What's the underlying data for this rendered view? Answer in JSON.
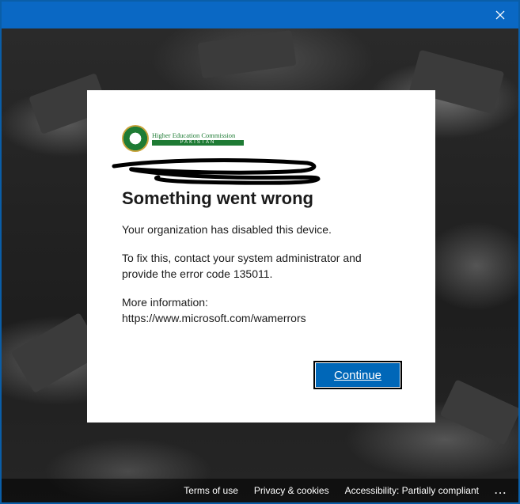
{
  "window": {
    "close_glyph": "✕",
    "accent": "#0a68c4"
  },
  "dialog": {
    "logo": {
      "name": "Higher Education Commission",
      "country": "PAKISTAN"
    },
    "title": "Something went wrong",
    "message": "Your organization has disabled this device.",
    "fix": "To fix this, contact your system administrator and provide the error code 135011.",
    "more_info_label": "More information:",
    "more_info_url": "https://www.microsoft.com/wamerrors",
    "continue_label": "Continue",
    "button_color": "#0067b8"
  },
  "footer": {
    "terms": "Terms of use",
    "privacy": "Privacy & cookies",
    "accessibility": "Accessibility: Partially compliant",
    "more": "..."
  }
}
